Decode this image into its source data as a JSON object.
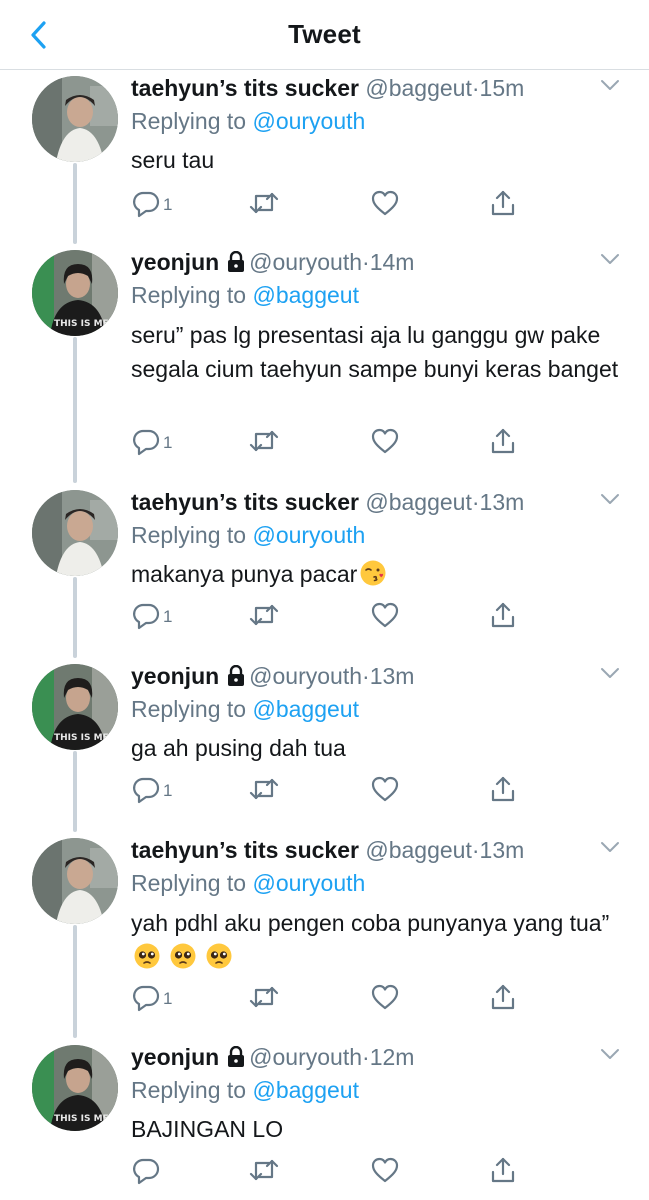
{
  "nav": {
    "title": "Tweet"
  },
  "tweets": [
    {
      "name": "taehyun’s tits sucker",
      "handle": "@baggeut",
      "dot": "·",
      "time": "15m",
      "replying_prefix": "Replying to ",
      "replying_to": "@ouryouth",
      "text": "seru tau",
      "reply_count": "1",
      "locked": false
    },
    {
      "name": "yeonjun",
      "handle": "@ouryouth",
      "dot": "·",
      "time": "14m",
      "replying_prefix": "Replying to ",
      "replying_to": "@baggeut",
      "text": "seru” pas lg presentasi aja lu ganggu gw pake segala cium taehyun sampe bunyi keras banget",
      "reply_count": "1",
      "locked": true
    },
    {
      "name": "taehyun’s tits sucker",
      "handle": "@baggeut",
      "dot": "·",
      "time": "13m",
      "replying_prefix": "Replying to ",
      "replying_to": "@ouryouth",
      "text": "makanya punya pacar",
      "emoji": "kiss-face",
      "reply_count": "1",
      "locked": false
    },
    {
      "name": "yeonjun",
      "handle": "@ouryouth",
      "dot": "·",
      "time": "13m",
      "replying_prefix": "Replying to ",
      "replying_to": "@baggeut",
      "text": "ga ah pusing dah tua",
      "reply_count": "1",
      "locked": true
    },
    {
      "name": "taehyun’s tits sucker",
      "handle": "@baggeut",
      "dot": "·",
      "time": "13m",
      "replying_prefix": "Replying to ",
      "replying_to": "@ouryouth",
      "text": "yah pdhl aku pengen coba punyanya yang tua”",
      "emoji": "pleading-face",
      "reply_count": "1",
      "locked": false
    },
    {
      "name": "yeonjun",
      "handle": "@ouryouth",
      "dot": "·",
      "time": "12m",
      "replying_prefix": "Replying to ",
      "replying_to": "@baggeut",
      "text": "BAJINGAN LO",
      "reply_count": "",
      "locked": true
    }
  ],
  "colors": {
    "accent": "#1da1f2",
    "secondary_text": "#657786",
    "thread_line": "#c9d2da"
  },
  "icons": [
    "back-chevron-icon",
    "lock-icon",
    "caret-down-icon",
    "reply-icon",
    "retweet-icon",
    "like-icon",
    "share-icon"
  ]
}
